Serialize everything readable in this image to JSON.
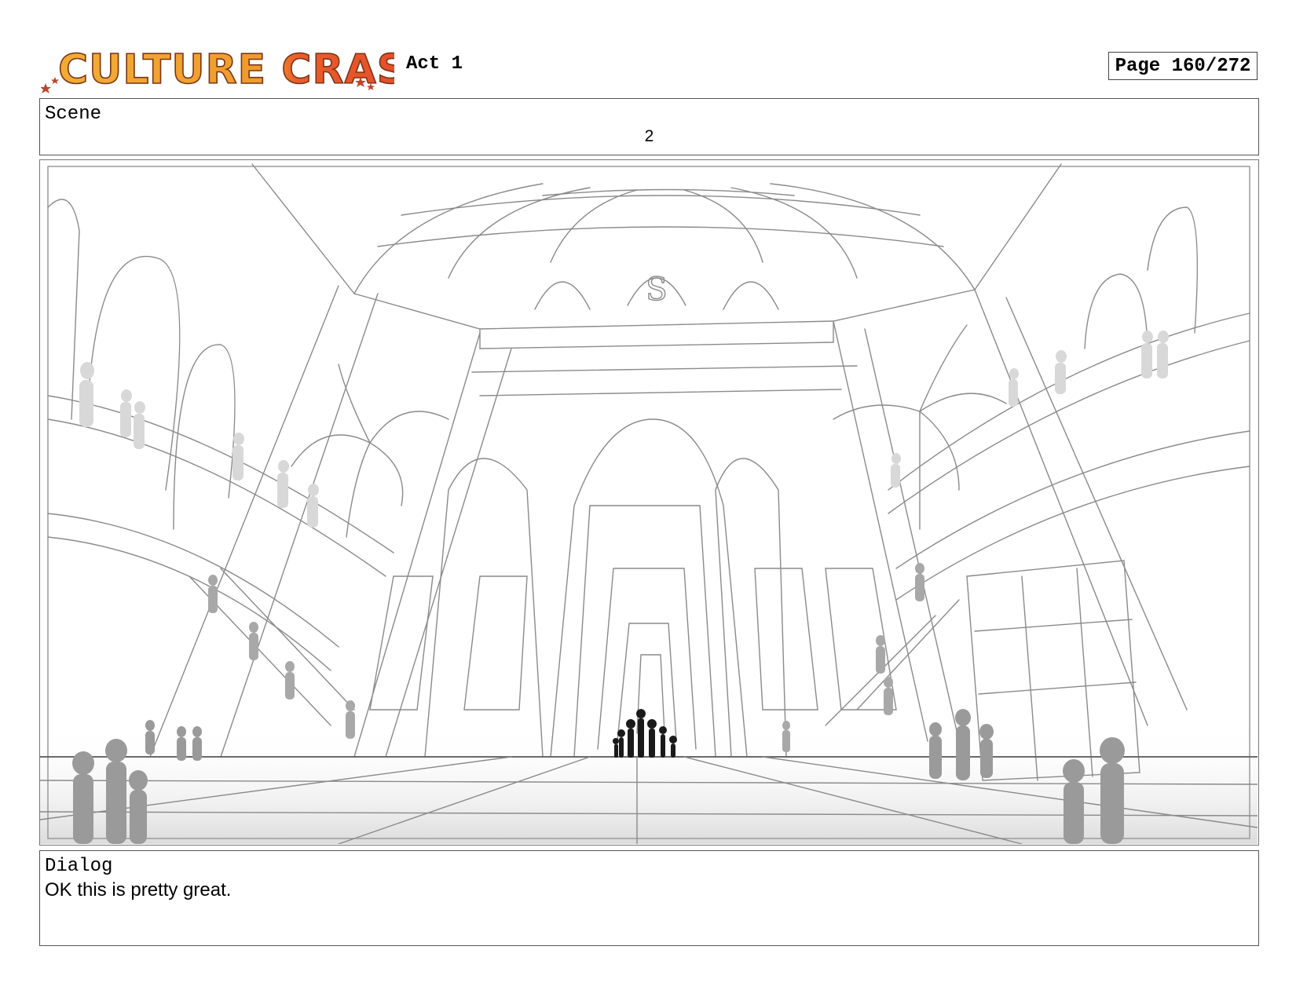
{
  "header": {
    "logo_text": "CULTURE CRASH",
    "act": "Act 1",
    "page": "Page 160/272"
  },
  "scene": {
    "label": "Scene",
    "number": "2"
  },
  "panel": {
    "sign_letter": "S"
  },
  "dialog": {
    "label": "Dialog",
    "text": "OK this is pretty great."
  },
  "colors": {
    "logo_orange": "#f0a030",
    "logo_red": "#e8532a",
    "logo_outline": "#8a3a18",
    "sketch_line": "#8a8a8a"
  }
}
